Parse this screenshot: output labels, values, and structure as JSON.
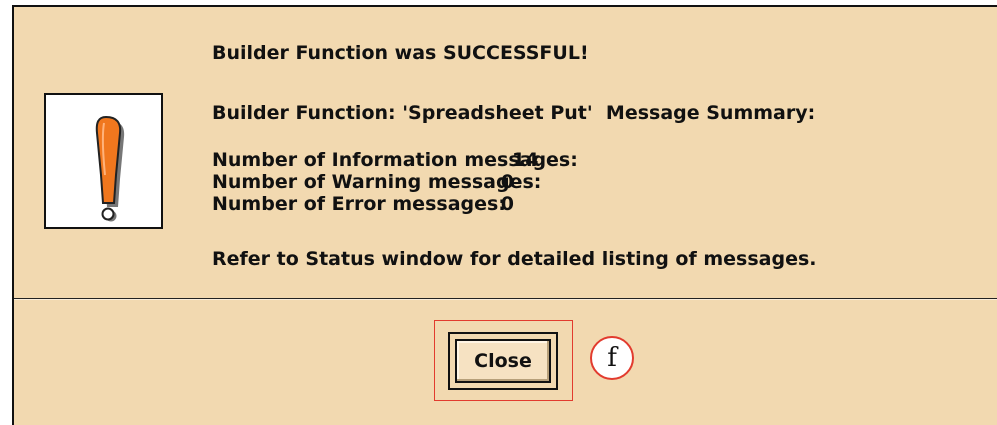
{
  "dialog": {
    "line_success": "Builder Function was SUCCESSFUL!",
    "line_summary": "Builder Function: 'Spreadsheet Put'  Message Summary:",
    "info_label": "Number of Information messages:",
    "info_count": "14",
    "warning_label": "Number of Warning messages:",
    "warning_count": "0",
    "error_label": "Number of Error messages:",
    "error_count": "0",
    "line_refer": "Refer to Status window for detailed listing of messages.",
    "icon": "exclamation-warning-icon",
    "close_label": "Close",
    "marker_label": "f"
  },
  "colors": {
    "dialog_background": "#f2d9b0",
    "icon_orange": "#f0771e",
    "highlight_red": "#e23b2e"
  }
}
